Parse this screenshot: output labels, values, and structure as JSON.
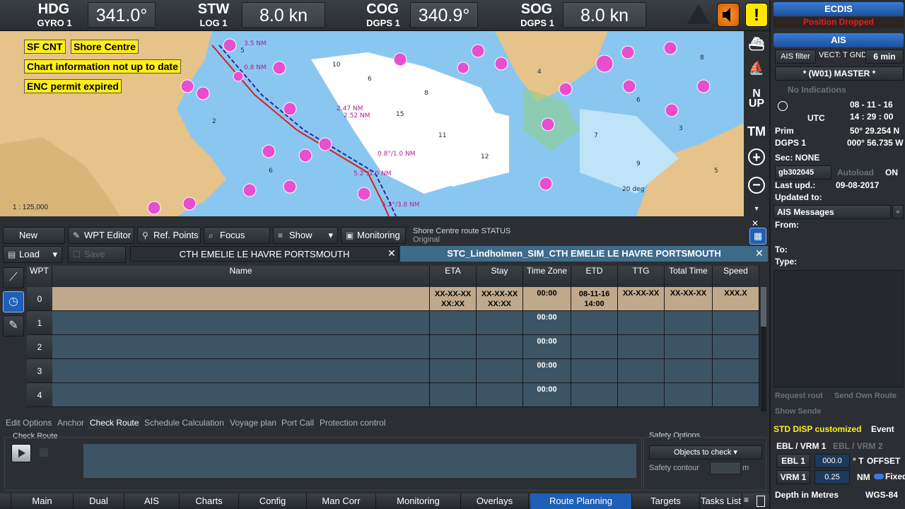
{
  "sensors": {
    "hdg": {
      "label": "HDG",
      "source": "GYRO 1",
      "value": "341.0°"
    },
    "stw": {
      "label": "STW",
      "source": "LOG 1",
      "value": "8.0 kn"
    },
    "cog": {
      "label": "COG",
      "source": "DGPS 1",
      "value": "340.9°"
    },
    "sog": {
      "label": "SOG",
      "source": "DGPS 1",
      "value": "8.0 kn"
    }
  },
  "chart": {
    "tags": {
      "sf_cnt": "SF CNT",
      "shore_centre": "Shore Centre",
      "info": "Chart information not up to date",
      "permit": "ENC permit expired"
    },
    "scale": "1 : 125,000",
    "labels": [
      "2.47 NM",
      "2.52 NM",
      "3.5 NM",
      "0.8 NM",
      "0.8°/1.0 NM",
      "5.2°/1.0 NM",
      "5.2°/3.8 NM",
      "20 deg"
    ]
  },
  "map_tools": {
    "north_up": "N\nUP",
    "tm": "TM"
  },
  "right_panel": {
    "ecdis": "ECDIS",
    "position_dropped": "Position Dropped",
    "ais": "AIS",
    "ais_filter": "AIS filter",
    "vect": "VECT: T GND",
    "vect_time": "6 min",
    "master": "* (W01) MASTER *",
    "indications": "No Indications",
    "date": "08 - 11 - 16",
    "utc": "UTC",
    "time": "14 : 29 : 00",
    "prim": "Prim",
    "lat": "50° 29.254 N",
    "dgps": "DGPS 1",
    "lon": "000° 56.735 W",
    "sec": "Sec: NONE",
    "cell": "gb302045",
    "autoload": "Autoload",
    "on": "ON",
    "last_upd_label": "Last upd.:",
    "last_upd": "09-08-2017",
    "updated_to": "Updated to:",
    "ais_messages": "AIS Messages",
    "from": "From:",
    "to": "To:",
    "type": "Type:",
    "request_route": "Request rout",
    "send_own": "Send Own Route",
    "show_sende": "Show Sende",
    "std_disp": "STD DISP customized",
    "event": "Event",
    "ebl_vrm_1": "EBL / VRM 1",
    "ebl_vrm_2": "EBL / VRM 2",
    "ebl1": "EBL 1",
    "ebl1_val": "000.0",
    "ebl1_unit": "° T",
    "offset": "OFFSET",
    "vrm1": "VRM 1",
    "vrm1_val": "0.25",
    "vrm1_unit": "NM",
    "fixed": "Fixed",
    "depth": "Depth in Metres",
    "wgs": "WGS-84"
  },
  "route_toolbar": {
    "new": "New",
    "wpt_editor": "WPT Editor",
    "ref_points": "Ref. Points",
    "focus": "Focus",
    "show": "Show",
    "monitoring": "Monitoring",
    "status_line1": "Shore Centre route STATUS",
    "status_line2": "Original",
    "load": "Load",
    "save": "Save",
    "tab1": "CTH EMELIE LE HAVRE PORTSMOUTH",
    "tab2": "STC_Lindholmen_SIM_CTH EMELIE LE HAVRE PORTSMOUTH"
  },
  "table": {
    "headers": [
      "WPT",
      "Name",
      "ETA",
      "Stay",
      "Time Zone",
      "ETD",
      "TTG",
      "Total Time",
      "Speed"
    ],
    "rows": [
      {
        "wpt": "0",
        "eta": "XX-XX-XX\nXX:XX",
        "stay": "XX-XX-XX\nXX:XX",
        "tz": "00:00",
        "etd": "08-11-16\n14:00",
        "ttg": "XX-XX-XX",
        "total": "XX-XX-XX",
        "speed": "XXX.X"
      },
      {
        "wpt": "1",
        "tz": "00:00"
      },
      {
        "wpt": "2",
        "tz": "00:00"
      },
      {
        "wpt": "3",
        "tz": "00:00"
      },
      {
        "wpt": "4",
        "tz": "00:00"
      }
    ]
  },
  "option_tabs": [
    "Edit Options",
    "Anchor",
    "Check Route",
    "Schedule Calculation",
    "Voyage plan",
    "Port Call",
    "Protection control"
  ],
  "check_route": {
    "title": "Check Route",
    "safety_title": "Safety Options",
    "objects": "Objects to check",
    "safety_contour": "Safety contour",
    "unit": "m"
  },
  "bottom_nav": [
    "Main",
    "Dual",
    "AIS",
    "Charts",
    "Config",
    "Man Corr",
    "Monitoring",
    "Overlays",
    "Route Planning",
    "Targets",
    "Tasks List"
  ],
  "colors": {
    "accent": "#1e5fb8",
    "warning": "#ffef1a",
    "alarm": "#e02020",
    "magenta": "#e84fd0",
    "land": "#e6c38a",
    "shallow": "#8ac7f0"
  }
}
